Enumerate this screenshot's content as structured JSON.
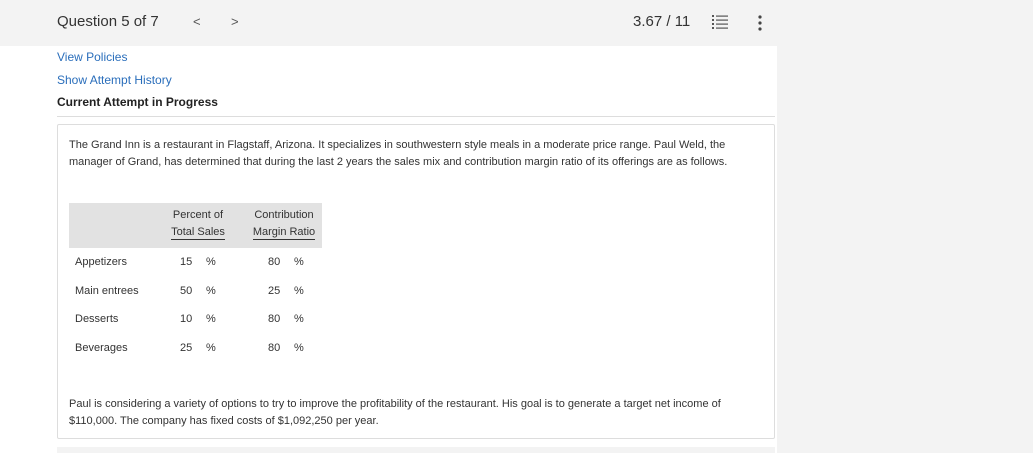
{
  "header": {
    "question_label": "Question 5 of 7",
    "prev_label": "<",
    "next_label": ">",
    "score": "3.67 / 11",
    "list_icon": "list-icon",
    "more_icon": "more-vertical-icon"
  },
  "links": {
    "view_policies": "View Policies",
    "attempt_history": "Show Attempt History"
  },
  "attempt_status": "Current Attempt in Progress",
  "problem": {
    "intro": "The Grand Inn is a restaurant in Flagstaff, Arizona. It specializes in southwestern style meals in a moderate price range. Paul Weld, the manager of Grand, has determined that during the last 2 years the sales mix and contribution margin ratio of its offerings are as follows.",
    "table": {
      "col1_line1": "Percent of",
      "col1_line2": "Total Sales",
      "col2_line1": "Contribution",
      "col2_line2": "Margin Ratio",
      "rows": [
        {
          "label": "Appetizers",
          "pct": "15",
          "pct_unit": "%",
          "cm": "80",
          "cm_unit": "%"
        },
        {
          "label": "Main entrees",
          "pct": "50",
          "pct_unit": "%",
          "cm": "25",
          "cm_unit": "%"
        },
        {
          "label": "Desserts",
          "pct": "10",
          "pct_unit": "%",
          "cm": "80",
          "cm_unit": "%"
        },
        {
          "label": "Beverages",
          "pct": "25",
          "pct_unit": "%",
          "cm": "80",
          "cm_unit": "%"
        }
      ]
    },
    "closing": "Paul is considering a variety of options to try to improve the profitability of the restaurant. His goal is to generate a target net income of $110,000. The company has fixed costs of $1,092,250 per year."
  }
}
